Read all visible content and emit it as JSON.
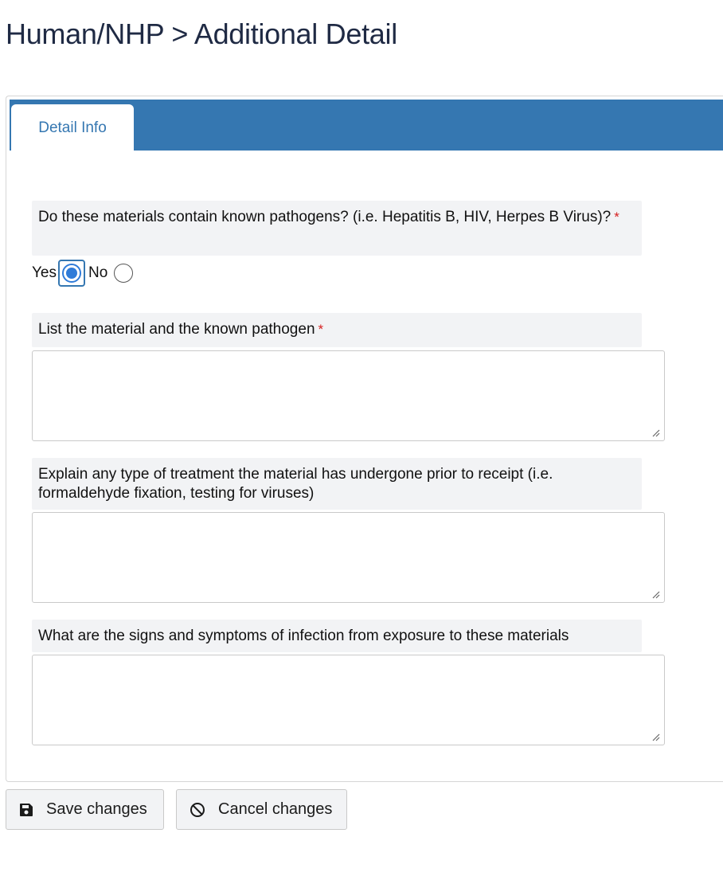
{
  "header": {
    "title": "Human/NHP > Additional Detail"
  },
  "tabs": [
    {
      "label": "Detail Info",
      "active": true
    }
  ],
  "form": {
    "q1": {
      "label": "Do these materials contain known pathogens? (i.e. Hepatitis B, HIV, Herpes B Virus)?",
      "required_mark": "*",
      "options": [
        {
          "label": "Yes",
          "checked": true
        },
        {
          "label": "No",
          "checked": false
        }
      ]
    },
    "q2": {
      "label": "List the material and the known pathogen",
      "required_mark": "*",
      "value": ""
    },
    "q3": {
      "label": "Explain any type of treatment the material has undergone prior to receipt (i.e. formaldehyde fixation, testing for viruses)",
      "value": ""
    },
    "q4": {
      "label": "What are the signs and symptoms of infection from exposure to these materials",
      "value": ""
    }
  },
  "actions": {
    "save_label": "Save changes",
    "save_icon": "floppy-disk-icon",
    "cancel_label": "Cancel changes",
    "cancel_icon": "ban-icon"
  },
  "colors": {
    "accent": "#3577b1",
    "required": "#d62020",
    "radio": "#2f7bd8"
  }
}
